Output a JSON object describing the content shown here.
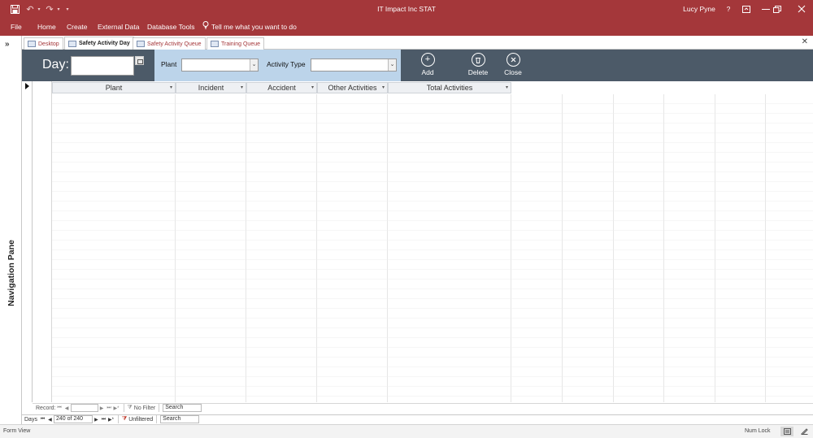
{
  "window": {
    "title": "IT Impact Inc STAT",
    "user": "Lucy Pyne",
    "help": "?",
    "colors": {
      "brand": "#a4373a",
      "header_band": "#4c5a68",
      "filter_band": "#bcd4ea"
    }
  },
  "ribbon": {
    "file": "File",
    "home": "Home",
    "create": "Create",
    "external_data": "External Data",
    "database_tools": "Database Tools",
    "tell_me": "Tell me what you want to do"
  },
  "nav_pane": {
    "label": "Navigation Pane"
  },
  "tabs": [
    {
      "label": "Desktop"
    },
    {
      "label": "Safety Activity Day"
    },
    {
      "label": "Safety Activity Queue"
    },
    {
      "label": "Training Queue"
    }
  ],
  "form_header": {
    "day_label": "Day:",
    "day_value": "",
    "plant_label": "Plant",
    "plant_value": "",
    "activity_type_label": "Activity Type",
    "activity_type_value": "",
    "add_label": "Add",
    "delete_label": "Delete",
    "close_label": "Close"
  },
  "datasheet": {
    "columns": [
      "Plant",
      "Incident",
      "Accident",
      "Other Activities",
      "Total Activities"
    ]
  },
  "inner_nav": {
    "record_label": "Record:",
    "no_filter": "No Filter",
    "search": "Search"
  },
  "outer_nav": {
    "label": "Days",
    "position": "240 of 240",
    "filter_status": "Unfiltered",
    "search": "Search"
  },
  "status_bar": {
    "view": "Form View",
    "num_lock": "Num Lock"
  }
}
